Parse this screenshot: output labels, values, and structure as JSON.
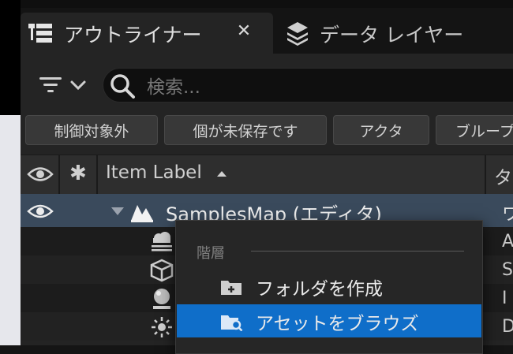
{
  "tabs": [
    {
      "label": "アウトライナー",
      "icon": "outliner-icon",
      "active": true
    },
    {
      "label": "データ レイヤー",
      "icon": "layers-icon",
      "active": false
    }
  ],
  "search": {
    "placeholder": "検索..."
  },
  "filters": [
    "制御対象外",
    "個が未保存です",
    "アクタ",
    "ブループ"
  ],
  "columns": {
    "label": "Item Label",
    "type": "タ"
  },
  "tree": {
    "root": {
      "label": "SamplesMap (エディタ)",
      "type": "ワ"
    },
    "children": [
      {
        "icon": "sky-atmosphere-icon",
        "type": "A"
      },
      {
        "icon": "cube-icon",
        "type": "S"
      },
      {
        "icon": "sphere-reflection-icon",
        "type": "I"
      },
      {
        "icon": "sun-light-icon",
        "type": "D"
      }
    ]
  },
  "context_menu": {
    "section": "階層",
    "items": [
      {
        "label": "フォルダを作成",
        "icon": "new-folder-icon",
        "highlighted": false
      },
      {
        "label": "アセットをブラウズ",
        "icon": "browse-folder-icon",
        "highlighted": true
      }
    ]
  },
  "colors": {
    "selection": "#3a4a5c",
    "menu_highlight": "#0f6ec9",
    "panel": "#242424"
  }
}
